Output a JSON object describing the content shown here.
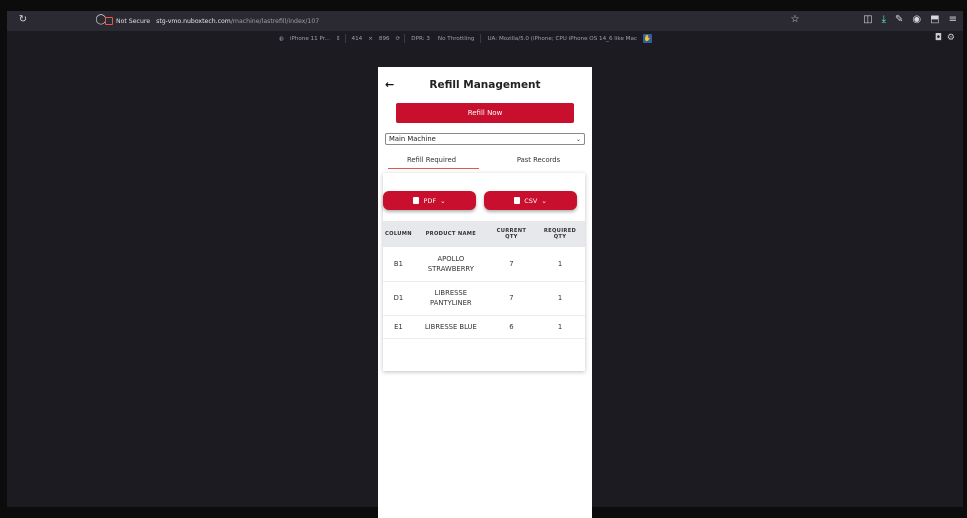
{
  "browser": {
    "security_label": "Not Secure",
    "url_host": "stg-vmo.nuboxtech.com",
    "url_path": "/machine/lastrefill/index/107",
    "icons": [
      "reload-icon",
      "shield-icon",
      "star-icon",
      "pocket-icon",
      "download-icon",
      "tools-icon",
      "account-icon",
      "extensions-icon",
      "menu-icon"
    ]
  },
  "rdm": {
    "device": "iPhone 11 Pr...",
    "width": "414",
    "times": "×",
    "height": "896",
    "dpr": "DPR: 3",
    "throttling": "No Throttling",
    "ua": "UA: Mozilla/5.0 (iPhone; CPU iPhone OS 14_6 like Mac"
  },
  "page": {
    "title": "Refill Management",
    "back_icon": "←",
    "refill_button": "Refill Now",
    "machine_select": "Main Machine",
    "tabs": [
      "Refill Required",
      "Past Records"
    ],
    "export": {
      "pdf": "PDF",
      "csv": "CSV"
    },
    "table": {
      "headers": [
        "COLUMN",
        "PRODUCT NAME",
        "CURRENT QTY",
        "REQUIRED QTY"
      ],
      "rows": [
        {
          "column": "B1",
          "product": "APOLLO STRAWBERRY",
          "current": "7",
          "required": "1"
        },
        {
          "column": "D1",
          "product": "LIBRESSE PANTYLINER",
          "current": "7",
          "required": "1"
        },
        {
          "column": "E1",
          "product": "LIBRESSE BLUE",
          "current": "6",
          "required": "1"
        }
      ]
    }
  },
  "colors": {
    "accent": "#c8102e",
    "tab_underline": "#e4574f",
    "table_header_bg": "#e6e8ec"
  }
}
